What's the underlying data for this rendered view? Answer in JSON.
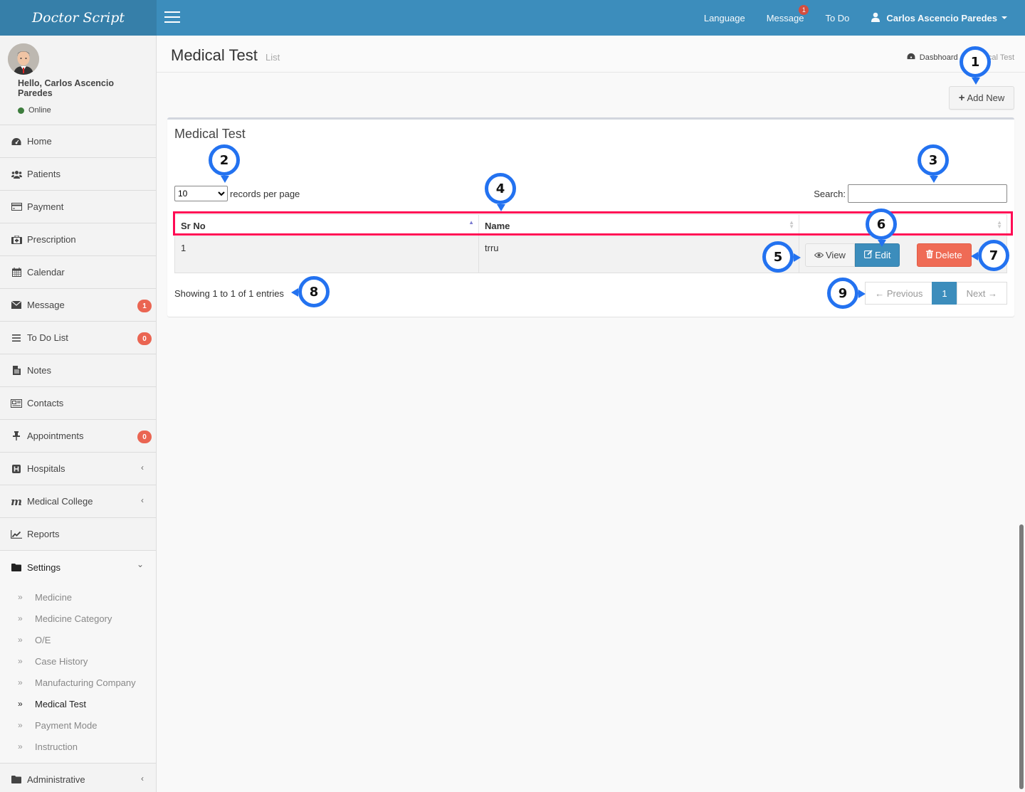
{
  "app": {
    "logo": "Doctor Script"
  },
  "topnav": {
    "language": "Language",
    "message": "Message",
    "message_badge": "1",
    "todo": "To Do",
    "user": "Carlos Ascencio Paredes"
  },
  "user_panel": {
    "greeting": "Hello, Carlos Ascencio Paredes",
    "status": "Online"
  },
  "sidebar": {
    "items": [
      {
        "label": "Home",
        "icon": "dashboard-icon"
      },
      {
        "label": "Patients",
        "icon": "users-icon"
      },
      {
        "label": "Payment",
        "icon": "credit-card-icon"
      },
      {
        "label": "Prescription",
        "icon": "medkit-icon"
      },
      {
        "label": "Calendar",
        "icon": "calendar-icon"
      },
      {
        "label": "Message",
        "icon": "envelope-icon",
        "badge": "1"
      },
      {
        "label": "To Do List",
        "icon": "list-icon",
        "badge": "0"
      },
      {
        "label": "Notes",
        "icon": "file-text-icon"
      },
      {
        "label": "Contacts",
        "icon": "newspaper-icon"
      },
      {
        "label": "Appointments",
        "icon": "thumb-tack-icon",
        "badge": "0"
      },
      {
        "label": "Hospitals",
        "icon": "hospital-icon"
      },
      {
        "label": "Medical College",
        "icon": "medical-college-icon"
      },
      {
        "label": "Reports",
        "icon": "line-chart-icon"
      },
      {
        "label": "Settings",
        "icon": "folder-icon"
      },
      {
        "label": "Administrative",
        "icon": "folder-icon"
      }
    ],
    "settings_submenu": [
      "Medicine",
      "Medicine Category",
      "O/E",
      "Case History",
      "Manufacturing Company",
      "Medical Test",
      "Payment Mode",
      "Instruction"
    ],
    "active_submenu": "Medical Test"
  },
  "page": {
    "title": "Medical Test",
    "subtitle": "List",
    "breadcrumb": {
      "home": "Dasbhoard",
      "current": "Medical Test"
    },
    "add_new": "Add New"
  },
  "box": {
    "title": "Medical Test",
    "length_value": "10",
    "length_label": "records per page",
    "search_label": "Search:",
    "search_value": "",
    "columns": [
      "Sr No",
      "Name",
      ""
    ],
    "rows": [
      {
        "sr_no": "1",
        "name": "trru"
      }
    ],
    "actions": {
      "view": "View",
      "edit": "Edit",
      "delete": "Delete"
    },
    "info": "Showing 1 to 1 of 1 entries",
    "pagination": {
      "previous": "← Previous",
      "current": "1",
      "next": "Next →"
    }
  },
  "annotations": [
    "1",
    "2",
    "3",
    "4",
    "5",
    "6",
    "7",
    "8",
    "9"
  ],
  "colors": {
    "primary": "#3c8dbc",
    "danger": "#ef6b55",
    "highlight": "#ff0a54",
    "marker": "#2372f0"
  }
}
